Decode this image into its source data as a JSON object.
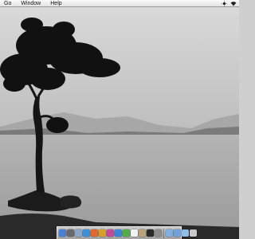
{
  "menubar": {
    "items": [
      "Go",
      "Window",
      "Help"
    ],
    "status_icons": [
      "brightness-icon",
      "wifi-icon"
    ]
  },
  "dock": {
    "apps": [
      {
        "name": "finder-icon",
        "color": "#4a7fd6"
      },
      {
        "name": "dashboard-icon",
        "color": "#6a6a6a"
      },
      {
        "name": "mail-icon",
        "color": "#8aa6c8"
      },
      {
        "name": "safari-icon",
        "color": "#3b8fd9"
      },
      {
        "name": "firefox-icon",
        "color": "#e2692b"
      },
      {
        "name": "chrome-icon",
        "color": "#d9a026"
      },
      {
        "name": "itunes-icon",
        "color": "#c34a9a"
      },
      {
        "name": "app-store-icon",
        "color": "#3c86d8"
      },
      {
        "name": "messages-icon",
        "color": "#4fae4a"
      },
      {
        "name": "calendar-icon",
        "color": "#f2f2f2"
      },
      {
        "name": "photos-icon",
        "color": "#b8a37a"
      },
      {
        "name": "terminal-icon",
        "color": "#2a2a2a"
      },
      {
        "name": "system-preferences-icon",
        "color": "#8c8c8c"
      }
    ],
    "right_items": [
      {
        "name": "documents-folder-icon",
        "color": "#7fb0e0"
      },
      {
        "name": "downloads-folder-icon",
        "color": "#6fa3d9"
      },
      {
        "name": "applications-folder-icon",
        "color": "#8fbde8"
      },
      {
        "name": "trash-icon",
        "color": "#c9c9c9"
      }
    ]
  }
}
